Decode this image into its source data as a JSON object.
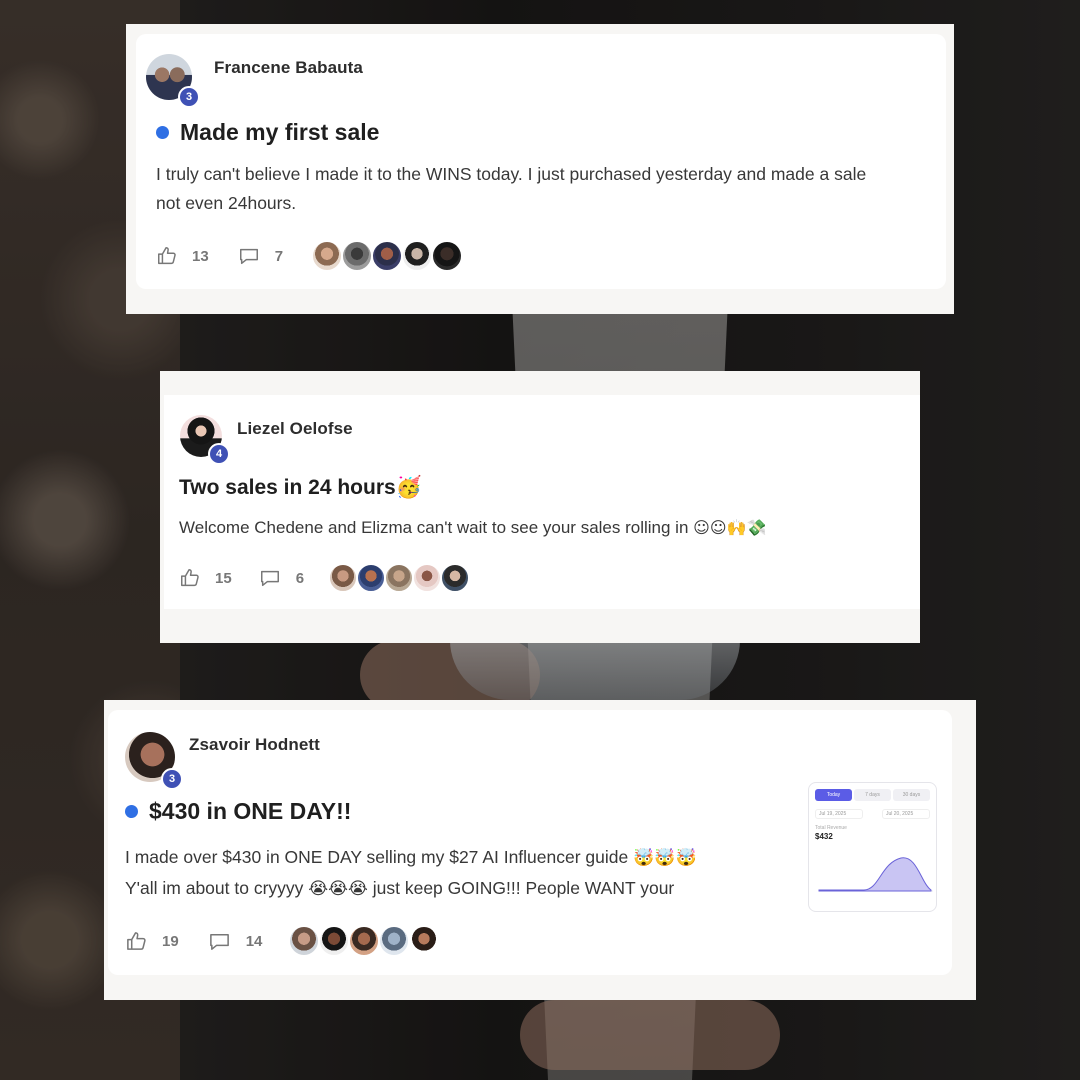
{
  "posts": [
    {
      "author": "Francene Babauta",
      "level": "3",
      "title": "Made my first sale",
      "body_line1": "I truly can't believe I made it to the WINS today. I just purchased yesterday and made a sale",
      "body_line2": "not even 24hours.",
      "likes": "13",
      "comments": "7"
    },
    {
      "author": "Liezel Oelofse",
      "level": "4",
      "title": "Two sales in 24 hours",
      "title_emoji": "🥳",
      "body": "Welcome Chedene and Elizma can't wait to see your sales rolling in",
      "body_emoji": "☺☺🙌💸",
      "likes": "15",
      "comments": "6"
    },
    {
      "author": "Zsavoir Hodnett",
      "level": "3",
      "title": "$430 in ONE DAY!!",
      "body_line1": "I made over $430 in ONE DAY selling my $27 AI Influencer guide",
      "body_line1_emoji": "🤯🤯🤯",
      "body_line2": "Y'all im about to cryyyy",
      "body_line2_emoji": "😭😭😭",
      "body_line2_tail": "just keep GOING!!! People WANT your",
      "likes": "19",
      "comments": "14",
      "attachment": {
        "tab1": "Today",
        "tab2": "7 days",
        "tab3": "30 days",
        "range_from": "Jul 19, 2025",
        "range_to": "Jul 20, 2025",
        "metric_label": "Total Revenue",
        "metric_value": "$432"
      }
    }
  ],
  "colors": {
    "accent_dot": "#2f6fe4",
    "level_badge": "#3f51b5",
    "chart_fill": "#b9b4f0"
  },
  "icons": {
    "like": "thumbs-up-icon",
    "comment": "speech-bubble-icon"
  }
}
